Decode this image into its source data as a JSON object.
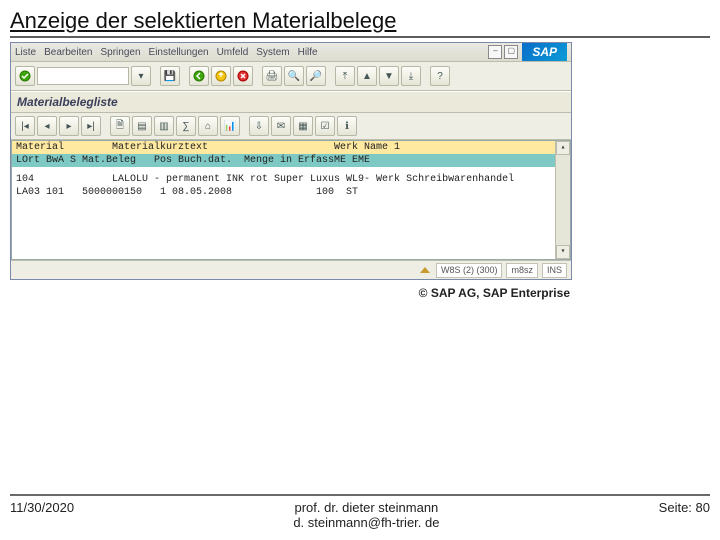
{
  "slide_title": "Anzeige der selektierten Materialbelege",
  "menubar": {
    "items": [
      "Liste",
      "Bearbeiten",
      "Springen",
      "Einstellungen",
      "Umfeld",
      "System",
      "Hilfe"
    ],
    "logo": "SAP"
  },
  "subheader": "Materialbelegliste",
  "list": {
    "hdr1": "Material        Materialkurztext                     Werk Name 1",
    "hdr2": "LOrt BwA S Mat.Beleg   Pos Buch.dat.  Menge in ErfassME EME",
    "row1": "104             LALOLU - permanent INK rot Super Luxus WL9- Werk Schreibwarenhandel",
    "row2": "LA03 101   5000000150   1 08.05.2008              100  ST"
  },
  "status": {
    "field1": "W8S (2) (300)",
    "field2": "m8sz",
    "field3": "INS"
  },
  "caption": "© SAP AG, SAP Enterprise",
  "footer": {
    "date": "11/30/2020",
    "name": "prof. dr. dieter steinmann",
    "email": "d. steinmann@fh-trier. de",
    "page": "Seite: 80"
  }
}
